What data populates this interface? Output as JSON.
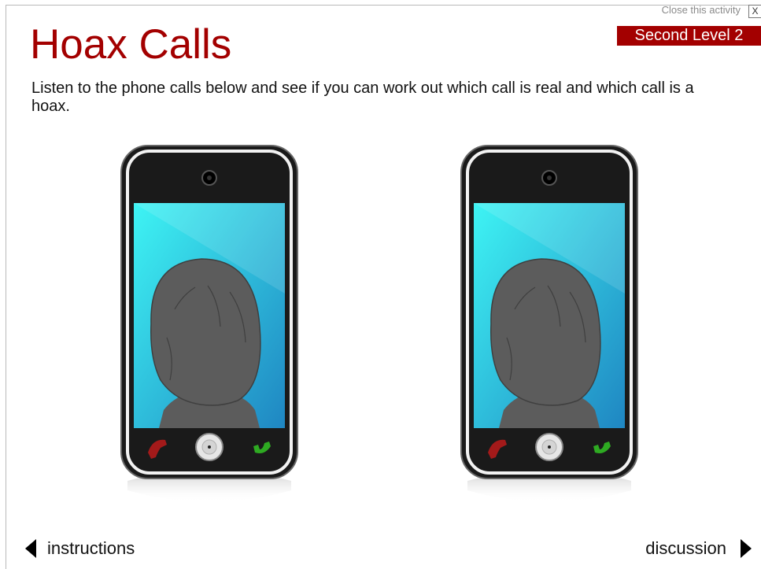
{
  "header": {
    "close_label": "Close this activity",
    "close_icon_glyph": "X",
    "level_badge": "Second Level 2",
    "title": "Hoax Calls"
  },
  "main": {
    "instructions": "Listen to the phone calls below and see if you can work out which call is real and which call is a hoax."
  },
  "phones": [
    {
      "end_call_icon": "phone-red-icon",
      "answer_icon": "phone-green-icon",
      "caller_icon": "person-silhouette-icon"
    },
    {
      "end_call_icon": "phone-red-icon",
      "answer_icon": "phone-green-icon",
      "caller_icon": "person-silhouette-icon"
    }
  ],
  "footer": {
    "prev_label": "instructions",
    "next_label": "discussion"
  },
  "colors": {
    "brand_red": "#a30000",
    "screen_top": "#3ef4f4",
    "screen_bottom": "#1f86c2",
    "hangup_red": "#a31a1a",
    "answer_green": "#2eaa22"
  }
}
